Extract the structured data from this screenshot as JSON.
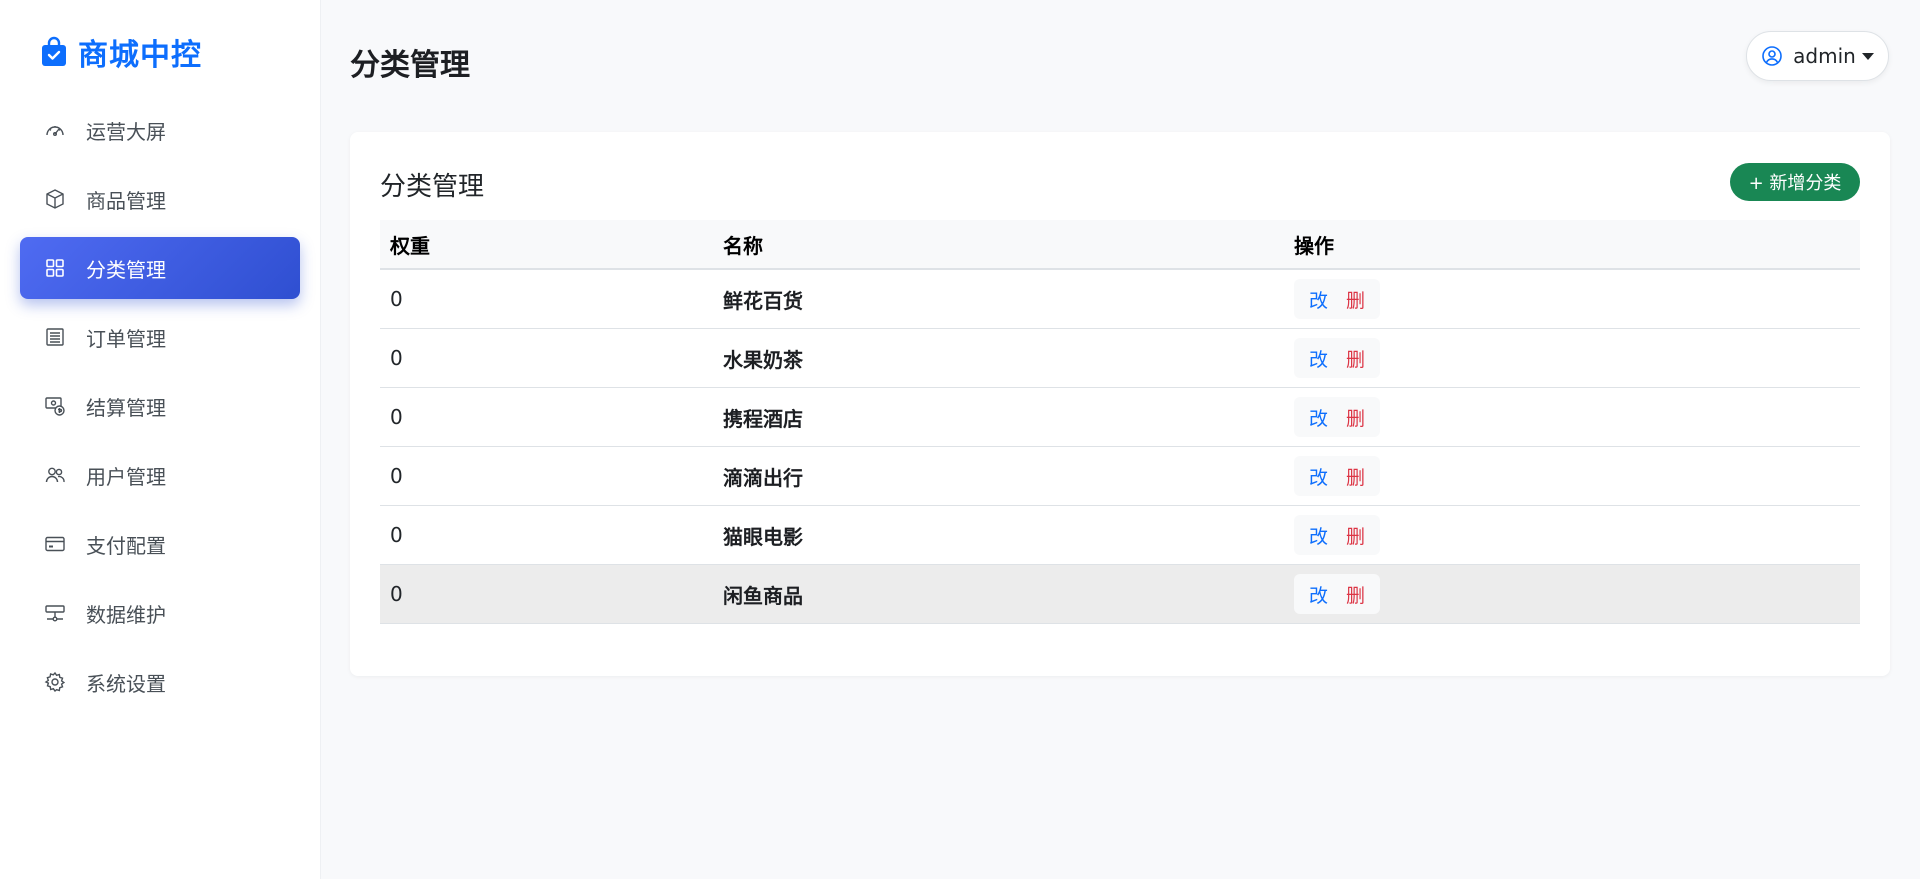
{
  "brand": {
    "name": "商城中控",
    "color": "#0d6efd"
  },
  "sidebar": {
    "items": [
      {
        "label": "运营大屏",
        "icon": "speedometer-icon",
        "active": false
      },
      {
        "label": "商品管理",
        "icon": "box-icon",
        "active": false
      },
      {
        "label": "分类管理",
        "icon": "grid-icon",
        "active": true
      },
      {
        "label": "订单管理",
        "icon": "list-icon",
        "active": false
      },
      {
        "label": "结算管理",
        "icon": "cash-settle-icon",
        "active": false
      },
      {
        "label": "用户管理",
        "icon": "people-icon",
        "active": false
      },
      {
        "label": "支付配置",
        "icon": "credit-card-icon",
        "active": false
      },
      {
        "label": "数据维护",
        "icon": "server-icon",
        "active": false
      },
      {
        "label": "系统设置",
        "icon": "gear-icon",
        "active": false
      }
    ]
  },
  "header": {
    "title": "分类管理",
    "user": "admin"
  },
  "card": {
    "title": "分类管理",
    "add_label": "+ 新增分类",
    "add_color": "#198754"
  },
  "table": {
    "columns": [
      "权重",
      "名称",
      "操作"
    ],
    "rows": [
      {
        "weight": "0",
        "name": "鲜花百货"
      },
      {
        "weight": "0",
        "name": "水果奶茶"
      },
      {
        "weight": "0",
        "name": "携程酒店"
      },
      {
        "weight": "0",
        "name": "滴滴出行"
      },
      {
        "weight": "0",
        "name": "猫眼电影"
      },
      {
        "weight": "0",
        "name": "闲鱼商品"
      }
    ],
    "edit_label": "改",
    "delete_label": "删"
  }
}
